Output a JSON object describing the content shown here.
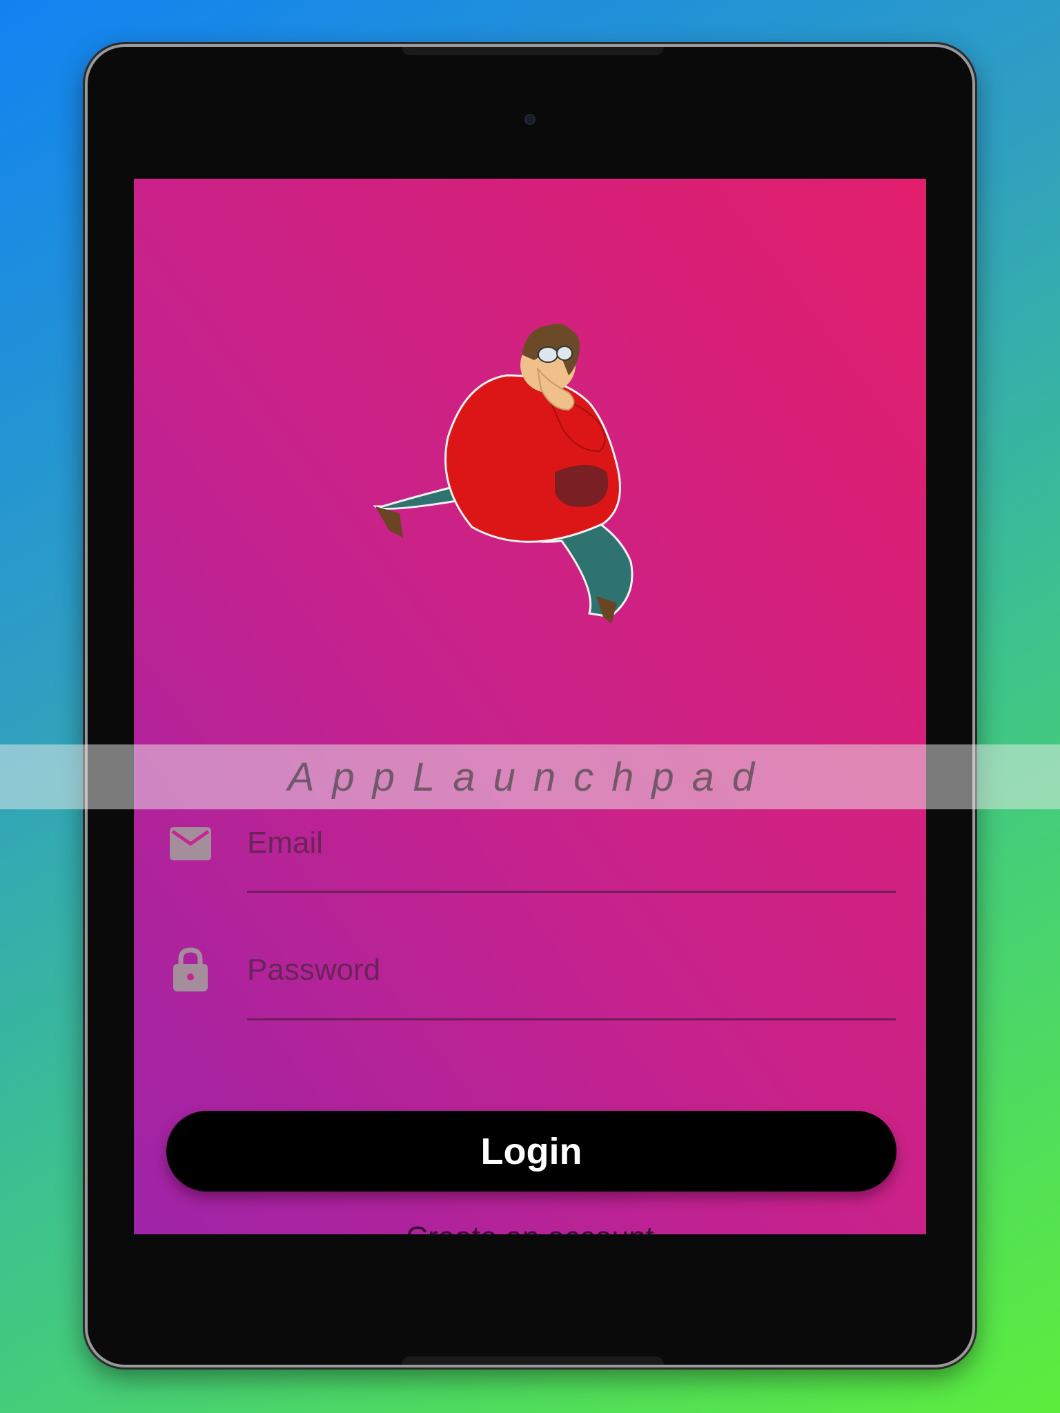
{
  "app": {
    "banner_text": "AppLaunchpad"
  },
  "login_form": {
    "email_placeholder": "Email",
    "password_placeholder": "Password",
    "login_label": "Login",
    "create_account_label": "Create an account"
  },
  "colors": {
    "screen_gradient_start": "#9e24a8",
    "screen_gradient_end": "#e21f6c",
    "button_background": "#000000",
    "button_text": "#ffffff"
  },
  "icons": {
    "email": "envelope-icon",
    "password": "lock-icon"
  }
}
